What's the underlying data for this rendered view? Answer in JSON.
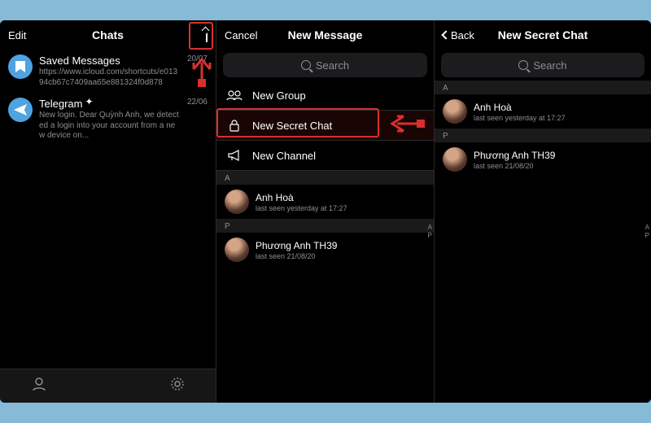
{
  "p1": {
    "edit": "Edit",
    "title": "Chats",
    "chats": [
      {
        "name": "Saved Messages",
        "sub": "https://www.icloud.com/shortcuts/e01394cb67c7409aa65e881324f0d878",
        "time": "20/07"
      },
      {
        "name": "Telegram",
        "sub": "New login. Dear Quỳnh Anh, we detected a login into your account from a new device on...",
        "time": "22/06",
        "verified": true
      }
    ]
  },
  "p2": {
    "cancel": "Cancel",
    "title": "New Message",
    "search": "Search",
    "opts": [
      {
        "label": "New Group"
      },
      {
        "label": "New Secret Chat"
      },
      {
        "label": "New Channel"
      }
    ],
    "sections": [
      {
        "h": "A",
        "items": [
          {
            "name": "Anh Hoà",
            "sub": "last seen yesterday at 17:27"
          }
        ]
      },
      {
        "h": "P",
        "items": [
          {
            "name": "Phương Anh TH39",
            "sub": "last seen 21/08/20"
          }
        ]
      }
    ]
  },
  "p3": {
    "back": "Back",
    "title": "New Secret Chat",
    "search": "Search",
    "sections": [
      {
        "h": "A",
        "items": [
          {
            "name": "Anh Hoà",
            "sub": "last seen yesterday at 17:27"
          }
        ]
      },
      {
        "h": "P",
        "items": [
          {
            "name": "Phương Anh TH39",
            "sub": "last seen 21/08/20"
          }
        ]
      }
    ]
  },
  "idx": [
    "A",
    "P"
  ]
}
